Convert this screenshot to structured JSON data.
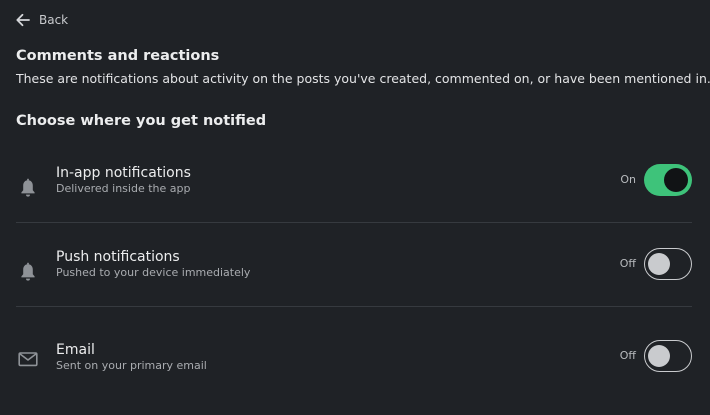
{
  "back": {
    "label": "Back"
  },
  "header": {
    "title": "Comments and reactions",
    "description": "These are notifications about activity on the posts you've created, commented on, or have been mentioned in."
  },
  "section": {
    "heading": "Choose where you get notified"
  },
  "settings": [
    {
      "icon": "bell-icon",
      "label": "In-app notifications",
      "sub": "Delivered inside the app",
      "state": "On",
      "enabled": true
    },
    {
      "icon": "bell-icon",
      "label": "Push notifications",
      "sub": "Pushed to your device immediately",
      "state": "Off",
      "enabled": false
    },
    {
      "icon": "envelope-icon",
      "label": "Email",
      "sub": "Sent on your primary email",
      "state": "Off",
      "enabled": false
    }
  ],
  "colors": {
    "background": "#1f2226",
    "toggle_on": "#3ec37a",
    "divider": "#363a3f"
  }
}
